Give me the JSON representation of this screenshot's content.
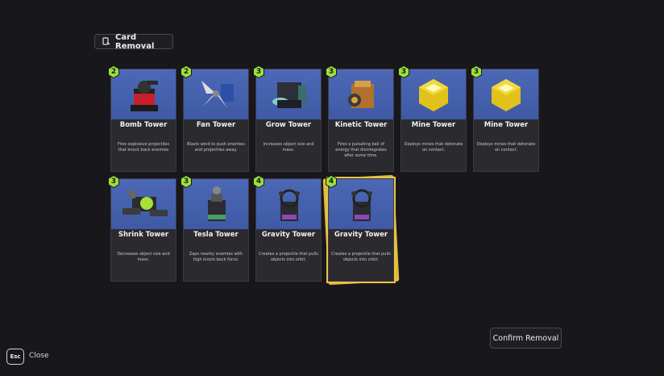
{
  "header": {
    "title": "Card Removal",
    "icon": "card-icon"
  },
  "cards": [
    {
      "name": "Bomb Tower",
      "cost": "2",
      "desc": "Fires explosive projectiles that knock back enemies",
      "icon": "bomb-tower-icon",
      "selected": false
    },
    {
      "name": "Fan Tower",
      "cost": "2",
      "desc": "Blasts wind to push enemies and projectiles away.",
      "icon": "fan-tower-icon",
      "selected": false
    },
    {
      "name": "Grow Tower",
      "cost": "3",
      "desc": "Increases object size and mass.",
      "icon": "grow-tower-icon",
      "selected": false
    },
    {
      "name": "Kinetic Tower",
      "cost": "3",
      "desc": "Fires a pulsating ball of energy that disintegrates after some time.",
      "icon": "kinetic-tower-icon",
      "selected": false
    },
    {
      "name": "Mine Tower",
      "cost": "3",
      "desc": "Deploys mines that detonate on contact.",
      "icon": "mine-tower-icon",
      "selected": false
    },
    {
      "name": "Mine Tower",
      "cost": "3",
      "desc": "Deploys mines that detonate on contact.",
      "icon": "mine-tower-icon",
      "selected": false
    },
    {
      "name": "Shrink Tower",
      "cost": "3",
      "desc": "Decreases object size and mass.",
      "icon": "shrink-tower-icon",
      "selected": false
    },
    {
      "name": "Tesla Tower",
      "cost": "3",
      "desc": "Zaps nearby enemies with high knock-back force.",
      "icon": "tesla-tower-icon",
      "selected": false
    },
    {
      "name": "Gravity Tower",
      "cost": "4",
      "desc": "Creates a projectile that pulls objects into orbit.",
      "icon": "gravity-tower-icon",
      "selected": false
    },
    {
      "name": "Gravity Tower",
      "cost": "4",
      "desc": "Creates a projectile that pulls objects into orbit.",
      "icon": "gravity-tower-icon",
      "selected": true
    }
  ],
  "footer": {
    "confirm_label": "Confirm Removal",
    "esc_key": "Esc",
    "close_label": "Close"
  },
  "colors": {
    "background": "#18171c",
    "card_art": "#4c68b6",
    "cost_badge": "#9be03a",
    "selection": "#e4bb3a"
  }
}
